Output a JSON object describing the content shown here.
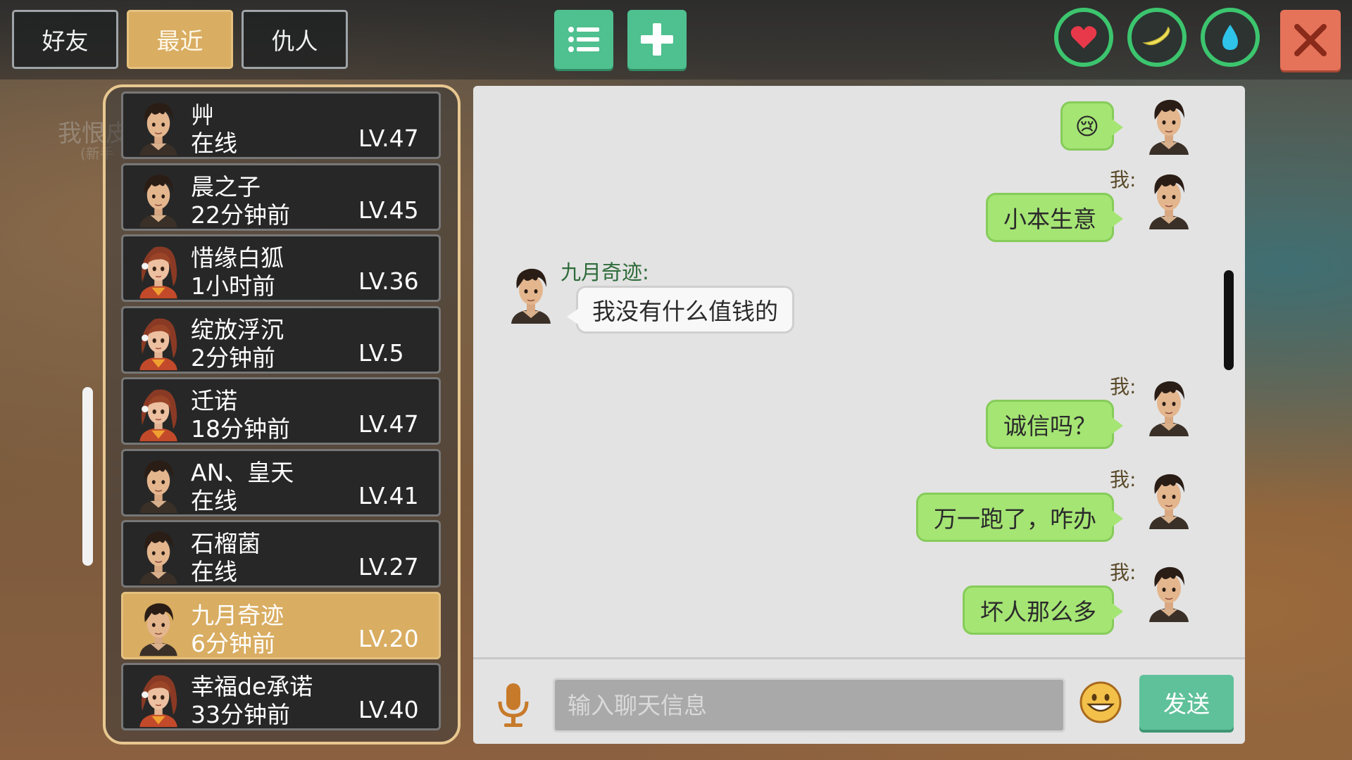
{
  "tabs": [
    {
      "label": "好友",
      "active": false
    },
    {
      "label": "最近",
      "active": true
    },
    {
      "label": "仇人",
      "active": false
    }
  ],
  "toolbar": {
    "list_icon": "list-icon",
    "add_icon": "plus-icon",
    "close_icon": "close-icon"
  },
  "stats": [
    {
      "icon": "heart-icon",
      "color": "#e8394a"
    },
    {
      "icon": "banana-icon",
      "color": "#f2e35a"
    },
    {
      "icon": "water-drop-icon",
      "color": "#2ec3e8"
    }
  ],
  "background_text": {
    "main": "我恨皮皮",
    "sub": "(新手"
  },
  "friends": [
    {
      "name": "艸",
      "status": "在线",
      "level": "LV.47",
      "avatar": "boy",
      "active": false
    },
    {
      "name": "晨之子",
      "status": "22分钟前",
      "level": "LV.45",
      "avatar": "boy",
      "active": false
    },
    {
      "name": "惜缘白狐",
      "status": "1小时前",
      "level": "LV.36",
      "avatar": "girl",
      "active": false
    },
    {
      "name": "绽放浮沉",
      "status": "2分钟前",
      "level": "LV.5",
      "avatar": "girl",
      "active": false
    },
    {
      "name": "迁诺",
      "status": "18分钟前",
      "level": "LV.47",
      "avatar": "girl",
      "active": false
    },
    {
      "name": "AN、皇天",
      "status": "在线",
      "level": "LV.41",
      "avatar": "boy",
      "active": false
    },
    {
      "name": "石榴菌",
      "status": "在线",
      "level": "LV.27",
      "avatar": "boy",
      "active": false
    },
    {
      "name": "九月奇迹",
      "status": "6分钟前",
      "level": "LV.20",
      "avatar": "boy",
      "active": true
    },
    {
      "name": "幸福de承诺",
      "status": "33分钟前",
      "level": "LV.40",
      "avatar": "girl",
      "active": false
    }
  ],
  "chat": {
    "messages": [
      {
        "from": "me",
        "label": "",
        "text": "😢"
      },
      {
        "from": "me",
        "label": "我:",
        "text": "小本生意"
      },
      {
        "from": "other",
        "label": "九月奇迹:",
        "text": "我没有什么值钱的"
      },
      {
        "from": "me",
        "label": "我:",
        "text": "诚信吗？"
      },
      {
        "from": "me",
        "label": "我:",
        "text": "万一跑了，咋办"
      },
      {
        "from": "me",
        "label": "我:",
        "text": "坏人那么多"
      }
    ],
    "input_placeholder": "输入聊天信息",
    "send_label": "发送",
    "mic_icon": "microphone-icon",
    "emoji_icon": "smiley-icon"
  }
}
